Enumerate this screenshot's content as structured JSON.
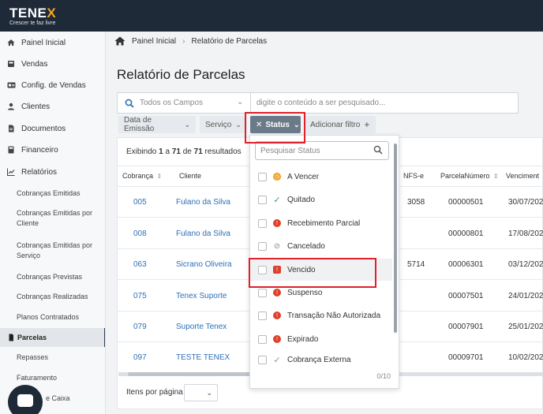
{
  "brand": {
    "name_main": "TENE",
    "name_x": "X",
    "tagline": "Crescer te faz livre"
  },
  "sidebar": {
    "items": [
      {
        "label": "Painel Inicial",
        "icon": "home-icon"
      },
      {
        "label": "Vendas",
        "icon": "cash-register-icon"
      },
      {
        "label": "Config. de Vendas",
        "icon": "id-card-icon"
      },
      {
        "label": "Clientes",
        "icon": "user-icon"
      },
      {
        "label": "Documentos",
        "icon": "document-icon"
      },
      {
        "label": "Financeiro",
        "icon": "calculator-icon"
      },
      {
        "label": "Relatórios",
        "icon": "chart-icon"
      }
    ],
    "sub_items": [
      {
        "label": "Cobranças Emitidas"
      },
      {
        "label": "Cobranças Emitidas por Cliente"
      },
      {
        "label": "Cobranças Emitidas por Serviço"
      },
      {
        "label": "Cobranças Previstas"
      },
      {
        "label": "Cobranças Realizadas"
      },
      {
        "label": "Planos Contratados"
      },
      {
        "label": "Parcelas"
      },
      {
        "label": "Repasses"
      },
      {
        "label": "Faturamento"
      },
      {
        "label": "e Caixa"
      }
    ],
    "active": "Parcelas"
  },
  "breadcrumb": {
    "home": "Painel Inicial",
    "current": "Relatório de Parcelas"
  },
  "page": {
    "title": "Relatório de Parcelas"
  },
  "search": {
    "field_select": "Todos os Campos",
    "placeholder": "digite o conteúdo a ser pesquisado..."
  },
  "filters": {
    "data_emissao": "Data de Emissão",
    "servico": "Serviço",
    "status": "Status",
    "status_remove": "✕",
    "add_filter": "Adicionar filtro",
    "add_plus": "+"
  },
  "results": {
    "prefix": "Exibindo",
    "from": "1",
    "sep_a": "a",
    "to": "71",
    "sep_de": "de",
    "total": "71",
    "suffix": "resultados"
  },
  "table": {
    "columns": [
      "Cobrança",
      "Cliente",
      "NFS-e",
      "ParcelaNúmero",
      "Venciment"
    ],
    "rows": [
      {
        "cobranca": "005",
        "cliente": "Fulano da Silva",
        "nfse": "3058",
        "parcela": "00000501",
        "venc": "30/07/202"
      },
      {
        "cobranca": "008",
        "cliente": "Fulano da Silva",
        "nfse": "",
        "parcela": "00000801",
        "venc": "17/08/202"
      },
      {
        "cobranca": "063",
        "cliente": "Sicrano Oliveira",
        "nfse": "5714",
        "parcela": "00006301",
        "venc": "03/12/202"
      },
      {
        "cobranca": "075",
        "cliente": "Tenex Suporte",
        "nfse": "",
        "parcela": "00007501",
        "venc": "24/01/202"
      },
      {
        "cobranca": "079",
        "cliente": "Suporte Tenex",
        "nfse": "",
        "parcela": "00007901",
        "venc": "25/01/202"
      },
      {
        "cobranca": "097",
        "cliente": "TESTE TENEX",
        "nfse": "",
        "parcela": "00009701",
        "venc": "10/02/202"
      }
    ]
  },
  "pagination": {
    "items_per_page": "Itens por página",
    "value": ""
  },
  "status_dropdown": {
    "search_placeholder": "Pesquisar Status",
    "options": [
      {
        "label": "A Vencer",
        "icon": "clock-icon",
        "color": "#f0a020"
      },
      {
        "label": "Quitado",
        "icon": "check-icon",
        "color": "#2f9e6e"
      },
      {
        "label": "Recebimento Parcial",
        "icon": "alert-icon",
        "color": "#e0402a"
      },
      {
        "label": "Cancelado",
        "icon": "ban-icon",
        "color": "#8a9099"
      },
      {
        "label": "Vencido",
        "icon": "calendar-alert-icon",
        "color": "#e0402a"
      },
      {
        "label": "Suspenso",
        "icon": "alert-icon",
        "color": "#e0402a"
      },
      {
        "label": "Transação Não Autorizada",
        "icon": "alert-icon",
        "color": "#e0402a"
      },
      {
        "label": "Expirado",
        "icon": "alert-icon",
        "color": "#e0402a"
      },
      {
        "label": "Cobrança Externa",
        "icon": "check-icon",
        "color": "#8a9099"
      }
    ],
    "selected_count": "0/10"
  },
  "colors": {
    "topbar": "#1e2a38",
    "link": "#2f6fb6",
    "highlight": "#e0202a",
    "accent": "#f5a623"
  }
}
